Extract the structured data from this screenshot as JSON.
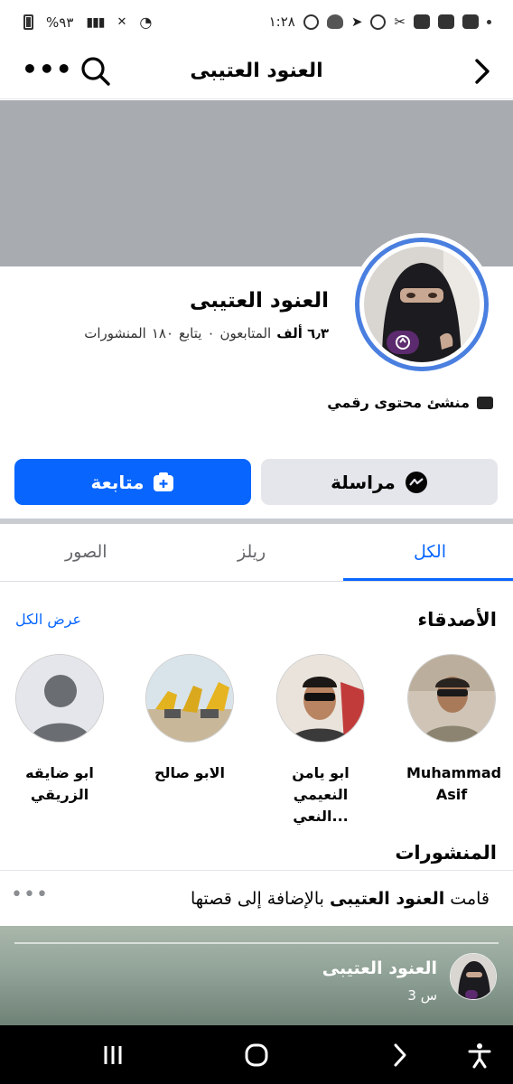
{
  "status_bar": {
    "time": "١:٢٨",
    "battery": "%٩٣"
  },
  "header": {
    "title": "العنود العتيبى",
    "more_label": "•••"
  },
  "profile": {
    "name": "العنود العتيبى",
    "followers_count": "٦٫٣ ألف",
    "followers_label": "المتابعون",
    "following_count": "٠",
    "following_label": "يتابع",
    "posts_count": "١٨٠",
    "posts_label": "المنشورات",
    "category": "منشئ محتوى رقمي"
  },
  "actions": {
    "follow_label": "متابعة",
    "message_label": "مراسلة"
  },
  "tabs": [
    {
      "label": "الكل",
      "active": true
    },
    {
      "label": "ريلز",
      "active": false
    },
    {
      "label": "الصور",
      "active": false
    }
  ],
  "friends": {
    "title": "الأصدقاء",
    "see_all": "عرض الكل",
    "items": [
      {
        "name_line1": "Muhammad",
        "name_line2": "Asif"
      },
      {
        "name_line1": "ابو يامن",
        "name_line2": "النعيمي النعي..."
      },
      {
        "name_line1": "الابو صالح",
        "name_line2": ""
      },
      {
        "name_line1": "ابو ضايقه",
        "name_line2": "الزريقي"
      }
    ]
  },
  "posts": {
    "title": "المنشورات",
    "story_prefix": "قامت",
    "story_name": "العنود العتيبى",
    "story_suffix": "بالإضافة إلى قصتها",
    "more_label": "•••",
    "author": "العنود العتيبى",
    "time": "3 س"
  },
  "colors": {
    "accent": "#0866ff",
    "avatar_ring": "#4a7fe0",
    "cover": "#a8abb0"
  }
}
